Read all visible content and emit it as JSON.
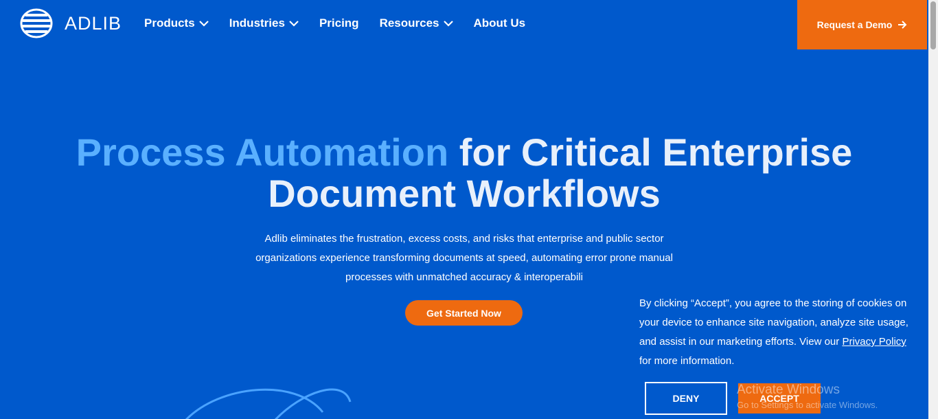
{
  "brand": {
    "name": "ADLIB"
  },
  "nav": {
    "items": [
      {
        "label": "Products",
        "dropdown": true
      },
      {
        "label": "Industries",
        "dropdown": true
      },
      {
        "label": "Pricing",
        "dropdown": false
      },
      {
        "label": "Resources",
        "dropdown": true
      },
      {
        "label": "About Us",
        "dropdown": false
      }
    ],
    "demo_label": "Request a Demo"
  },
  "hero": {
    "title_accent": "Process Automation",
    "title_rest_line1": "for Critical Enterprise",
    "title_line2": "Document Workflows",
    "description": "Adlib eliminates the frustration, excess costs, and risks that enterprise and public sector organizations experience transforming documents at speed, automating error prone manual processes with unmatched accuracy & interoperabili",
    "cta_label": "Get Started Now"
  },
  "cookie": {
    "text_before": "By clicking “Accept”, you agree to the storing of cookies on your device to enhance site navigation, analyze site usage, and assist in our marketing efforts. View our ",
    "link_label": "Privacy Policy",
    "text_after": " for more information.",
    "deny_label": "DENY",
    "accept_label": "ACCEPT"
  },
  "watermark": {
    "title": "Activate Windows",
    "subtitle": "Go to Settings to activate Windows."
  },
  "colors": {
    "background": "#0059cc",
    "accent_orange": "#ee6a10",
    "title_accent": "#5ab0ff",
    "text": "#ffffff"
  }
}
